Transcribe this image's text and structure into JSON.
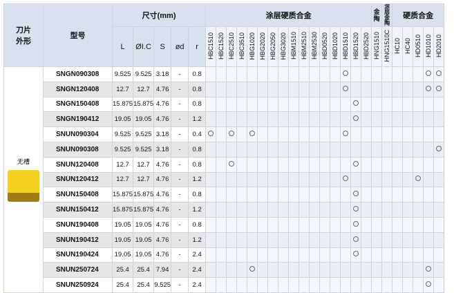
{
  "header": {
    "shape_col": "刀片\n外形",
    "model_col": "型号",
    "dims_group": "尺寸(mm)",
    "coated_group": "涂层硬质合金",
    "cermet_group": "金陶",
    "coated_cermet_group": "涂层金陶",
    "carbide_group": "硬质合金",
    "dim_labels": [
      "L",
      "ØI.C",
      "S",
      "ød",
      "r"
    ]
  },
  "grades": {
    "coated": [
      "HBC1510",
      "HBC1520",
      "HBC2510",
      "HBC3510",
      "HBG1020",
      "HBG2020",
      "HBG2050",
      "HBG3020",
      "HBM1510",
      "HBM2510",
      "HBM2530",
      "HBD0520",
      "HBD1020",
      "HBD1510",
      "HBD1520",
      "HBD2520"
    ],
    "cermet": [
      "HNG1510"
    ],
    "coated_cermet": [
      "HNG1510C"
    ],
    "carbide": [
      "HC10",
      "HC40",
      "HD0510",
      "HD1010",
      "HD2010"
    ]
  },
  "shape": {
    "label": "无槽",
    "colors": {
      "top": "#f5d21f",
      "bottom": "#a07a14"
    }
  },
  "rows": [
    {
      "model": "SNGN090308",
      "L": "9.525",
      "IC": "9.525",
      "S": "3.18",
      "d": "-",
      "r": "0.8",
      "marks": [
        13,
        21,
        22
      ]
    },
    {
      "model": "SNGN120408",
      "L": "12.7",
      "IC": "12.7",
      "S": "4.76",
      "d": "-",
      "r": "0.8",
      "marks": [
        13,
        21,
        22
      ]
    },
    {
      "model": "SNGN150408",
      "L": "15.875",
      "IC": "15.875",
      "S": "4.76",
      "d": "-",
      "r": "0.8",
      "marks": [
        14
      ]
    },
    {
      "model": "SNGN190412",
      "L": "19.05",
      "IC": "19.05",
      "S": "4.76",
      "d": "-",
      "r": "1.2",
      "marks": [
        14
      ]
    },
    {
      "model": "SNUN090304",
      "L": "9.525",
      "IC": "9.525",
      "S": "3.18",
      "d": "-",
      "r": "0.4",
      "marks": [
        0,
        2,
        4,
        13
      ]
    },
    {
      "model": "SNUN090308",
      "L": "9.525",
      "IC": "9.525",
      "S": "3.18",
      "d": "-",
      "r": "0.8",
      "marks": [
        22
      ]
    },
    {
      "model": "SNUN120408",
      "L": "12.7",
      "IC": "12.7",
      "S": "4.76",
      "d": "-",
      "r": "0.8",
      "marks": [
        2,
        14
      ]
    },
    {
      "model": "SNUN120412",
      "L": "12.7",
      "IC": "12.7",
      "S": "4.76",
      "d": "-",
      "r": "1.2",
      "marks": [
        13,
        20
      ]
    },
    {
      "model": "SNUN150408",
      "L": "15.875",
      "IC": "15.875",
      "S": "4.76",
      "d": "-",
      "r": "0.8",
      "marks": [
        14
      ]
    },
    {
      "model": "SNUN150412",
      "L": "15.875",
      "IC": "15.875",
      "S": "4.76",
      "d": "-",
      "r": "1.2",
      "marks": [
        14
      ]
    },
    {
      "model": "SNUN190408",
      "L": "19.05",
      "IC": "19.05",
      "S": "4.76",
      "d": "-",
      "r": "0.8",
      "marks": [
        14
      ]
    },
    {
      "model": "SNUN190412",
      "L": "19.05",
      "IC": "19.05",
      "S": "4.76",
      "d": "-",
      "r": "1.2",
      "marks": [
        14
      ]
    },
    {
      "model": "SNUN190424",
      "L": "19.05",
      "IC": "19.05",
      "S": "4.76",
      "d": "-",
      "r": "2.4",
      "marks": [
        14
      ]
    },
    {
      "model": "SNUN250724",
      "L": "25.4",
      "IC": "25.4",
      "S": "7.94",
      "d": "-",
      "r": "2.4",
      "marks": [
        4,
        21
      ]
    },
    {
      "model": "SNUN250924",
      "L": "25.4",
      "IC": "25.4",
      "S": "9.525",
      "d": "-",
      "r": "2.4",
      "marks": [
        21
      ]
    }
  ]
}
